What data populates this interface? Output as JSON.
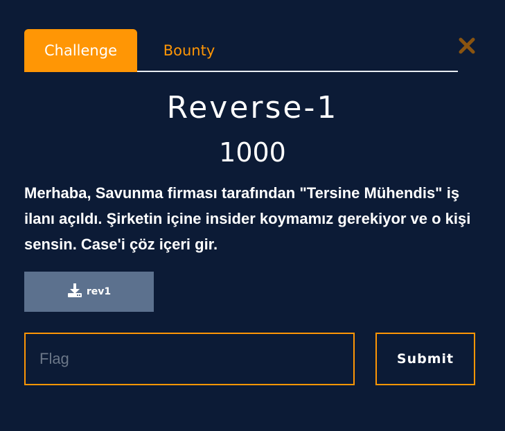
{
  "tabs": [
    {
      "label": "Challenge",
      "active": true
    },
    {
      "label": "Bounty",
      "active": false
    }
  ],
  "close_icon": "close-icon",
  "challenge": {
    "title": "Reverse-1",
    "points": "1000",
    "description": "Merhaba, Savunma firması tarafından \"Tersine Mühendis\" iş ilanı açıldı. Şirketin içine insider koymamız gerekiyor ve o kişi sensin. Case'i çöz içeri gir.",
    "file_label": "rev1",
    "file_icon": "download-icon"
  },
  "flag": {
    "placeholder": "Flag",
    "value": ""
  },
  "submit_label": "Submit",
  "colors": {
    "background": "#0c1b36",
    "accent": "#ff9605",
    "download_button": "#5c718e"
  }
}
